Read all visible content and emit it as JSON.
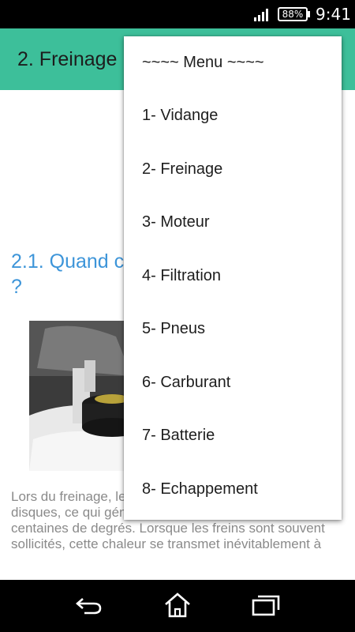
{
  "status_bar": {
    "battery": "88%",
    "time": "9:41",
    "signal_icon": "signal-bars-icon"
  },
  "action_bar": {
    "title": "2.  Freinage"
  },
  "content": {
    "section_heading": "2.1. Quand changer le liquide de frein ?",
    "body_text": "Lors du freinage, les plaquettes frottent contre les disques, ce qui génère une température de plusieurs centaines de degrés. Lorsque les freins sont souvent sollicités, cette chaleur se transmet inévitablement à"
  },
  "menu": {
    "header": "~~~~ Menu ~~~~",
    "items": [
      "1- Vidange",
      "2- Freinage",
      "3- Moteur",
      "4- Filtration",
      "5- Pneus",
      "6- Carburant",
      "7- Batterie",
      "8- Echappement"
    ]
  },
  "colors": {
    "action_bar": "#3dbf9a",
    "heading": "#3d95d9",
    "body_text": "#8a8a8a"
  },
  "nav_bar": {
    "icons": [
      "back-icon",
      "home-icon",
      "recent-apps-icon"
    ]
  }
}
